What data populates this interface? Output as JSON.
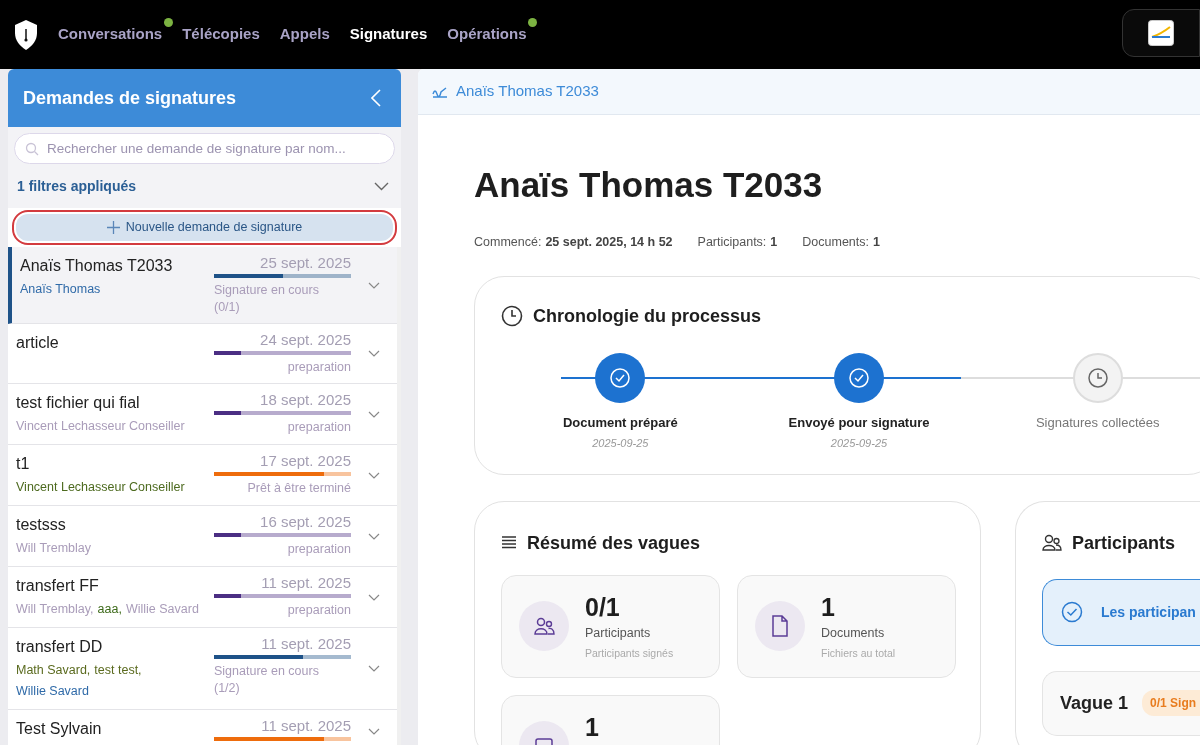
{
  "nav": {
    "items": [
      {
        "label": "Conversations",
        "selected": false,
        "dot": true
      },
      {
        "label": "Télécopies",
        "selected": false,
        "dot": false
      },
      {
        "label": "Appels",
        "selected": false,
        "dot": false
      },
      {
        "label": "Signatures",
        "selected": true,
        "dot": false
      },
      {
        "label": "Opérations",
        "selected": false,
        "dot": true
      }
    ]
  },
  "sidebar": {
    "title": "Demandes de signatures",
    "search": {
      "placeholder": "Rechercher une demande de signature par nom..."
    },
    "filters": "1 filtres appliqués",
    "new_button": "Nouvelle demande de signature",
    "items": [
      {
        "name": "Anaïs Thomas T2033",
        "date": "25 sept. 2025",
        "level": 0.5,
        "color": "#1e5288",
        "status": "Signature en cours (0/1)",
        "selected": true,
        "participants": [
          {
            "name": "Anaïs Thomas",
            "color": "#2f6aa8"
          }
        ]
      },
      {
        "name": "article",
        "date": "24 sept. 2025",
        "level": 0.2,
        "color": "#4b2e83",
        "status": "preparation",
        "selected": false
      },
      {
        "name": "test fichier qui fial",
        "date": "18 sept. 2025",
        "level": 0.2,
        "color": "#4b2e83",
        "status": "preparation",
        "selected": false,
        "participants": [
          {
            "name": "Vincent Lechasseur Conseiller",
            "color": "#a99cb9"
          }
        ]
      },
      {
        "name": "t1",
        "date": "17 sept. 2025",
        "level": 0.8,
        "color": "#ee6c0c",
        "status": "Prêt à être terminé",
        "selected": false,
        "participants": [
          {
            "name": "Vincent Lechasseur Conseiller",
            "color": "#4d6a1f"
          }
        ]
      },
      {
        "name": "testsss",
        "date": "16 sept. 2025",
        "level": 0.2,
        "color": "#4b2e83",
        "status": "preparation",
        "selected": false,
        "participants": [
          {
            "name": "Will Tremblay",
            "color": "#a99cb9"
          }
        ]
      },
      {
        "name": "transfert FF",
        "date": "11 sept. 2025",
        "level": 0.2,
        "color": "#4b2e83",
        "status": "preparation",
        "selected": false,
        "participants": [
          {
            "name": "Will Tremblay,",
            "color": "#a99cb9"
          },
          {
            "name": "aaa,",
            "color": "#3d6a1a"
          },
          {
            "name": "Willie Savard",
            "color": "#a99cb9"
          }
        ]
      },
      {
        "name": "transfert DD",
        "date": "11 sept. 2025",
        "level": 0.65,
        "color": "#1e5288",
        "status": "Signature en cours (1/2)",
        "selected": false,
        "participants": [
          {
            "name": "Math Savard,",
            "color": "#5a6a1e"
          },
          {
            "name": "test test,",
            "color": "#5a6a1e"
          },
          {
            "name": "Willie Savard",
            "color": "#2f6aa8"
          }
        ]
      },
      {
        "name": "Test Sylvain",
        "date": "11 sept. 2025",
        "level": 0.8,
        "color": "#ee6c0c",
        "selected": false
      }
    ]
  },
  "main": {
    "breadcrumb": "Anaïs Thomas T2033",
    "title": "Anaïs Thomas T2033",
    "meta": [
      {
        "label": "Commencé:",
        "value": "25 sept. 2025, 14 h 52"
      },
      {
        "label": "Participants:",
        "value": "1"
      },
      {
        "label": "Documents:",
        "value": "1"
      }
    ],
    "timeline": {
      "title": "Chronologie du processus",
      "steps": [
        {
          "label": "Document préparé",
          "date": "2025-09-25",
          "done": true
        },
        {
          "label": "Envoyé pour signature",
          "date": "2025-09-25",
          "done": true
        },
        {
          "label": "Signatures collectées",
          "done": false
        }
      ]
    },
    "summary": {
      "title": "Résumé des vagues",
      "stats": [
        {
          "kind": "participants",
          "value": "0/1",
          "label": "Participants",
          "sublabel": "Participants signés"
        },
        {
          "kind": "documents",
          "value": "1",
          "label": "Documents",
          "sublabel": "Fichiers au total"
        },
        {
          "kind": "calendar",
          "value": "1"
        }
      ]
    },
    "participants": {
      "title": "Participants",
      "alert": "Les participan",
      "waves": [
        {
          "label": "Vague 1",
          "badge": "0/1 Sign"
        }
      ]
    }
  }
}
